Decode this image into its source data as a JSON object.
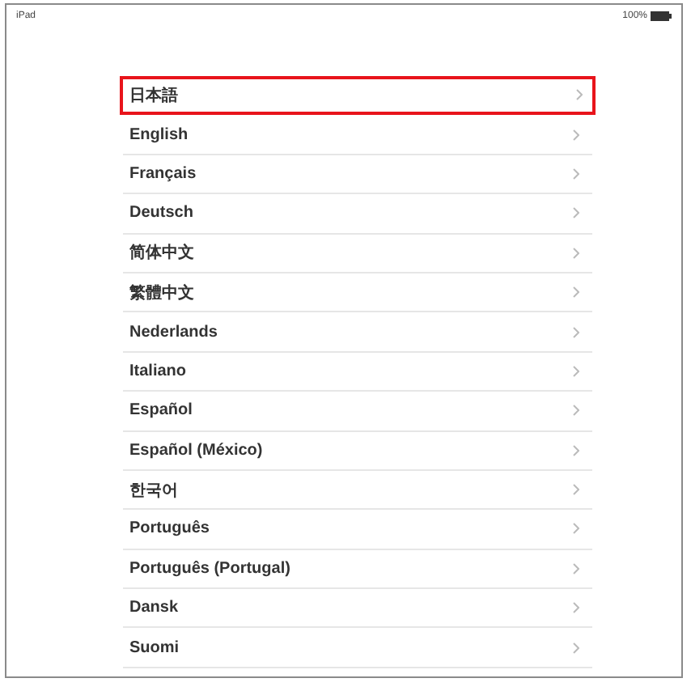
{
  "status_bar": {
    "device": "iPad",
    "battery": "100%"
  },
  "languages": [
    {
      "label": "日本語",
      "highlighted": true
    },
    {
      "label": "English",
      "highlighted": false
    },
    {
      "label": "Français",
      "highlighted": false
    },
    {
      "label": "Deutsch",
      "highlighted": false
    },
    {
      "label": "简体中文",
      "highlighted": false
    },
    {
      "label": "繁體中文",
      "highlighted": false
    },
    {
      "label": "Nederlands",
      "highlighted": false
    },
    {
      "label": "Italiano",
      "highlighted": false
    },
    {
      "label": "Español",
      "highlighted": false
    },
    {
      "label": "Español (México)",
      "highlighted": false
    },
    {
      "label": "한국어",
      "highlighted": false
    },
    {
      "label": "Português",
      "highlighted": false
    },
    {
      "label": "Português (Portugal)",
      "highlighted": false
    },
    {
      "label": "Dansk",
      "highlighted": false
    },
    {
      "label": "Suomi",
      "highlighted": false
    }
  ]
}
